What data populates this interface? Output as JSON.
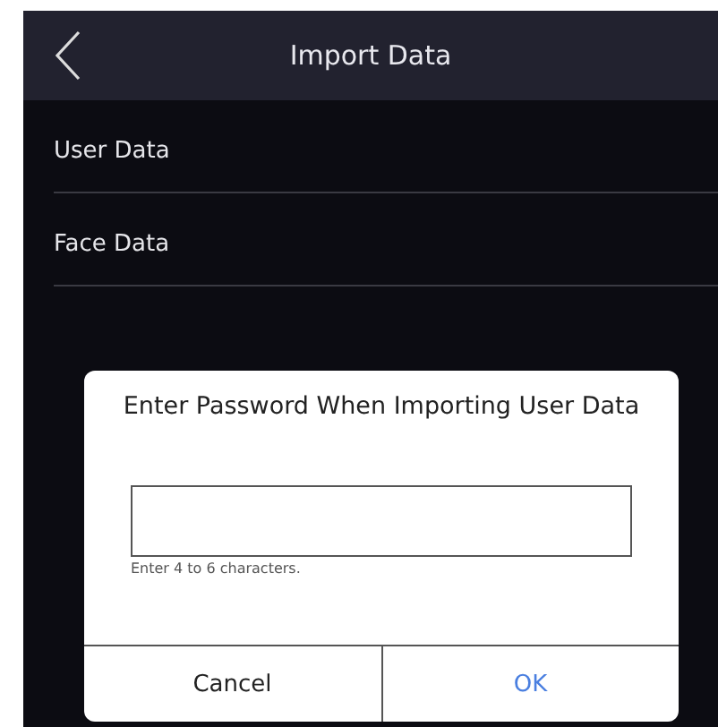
{
  "header": {
    "title": "Import Data"
  },
  "list": [
    {
      "label": "User Data"
    },
    {
      "label": "Face Data"
    }
  ],
  "dialog": {
    "title": "Enter Password When Importing User Data",
    "hint": "Enter 4 to 6 characters.",
    "buttons": [
      {
        "label": "Cancel",
        "kind": "cancel"
      },
      {
        "label": "OK",
        "kind": "confirm"
      }
    ]
  }
}
